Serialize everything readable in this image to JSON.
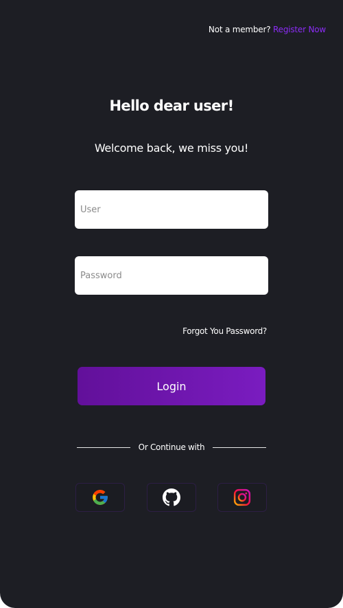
{
  "header": {
    "prompt": "Not a member?",
    "register_link": "Register Now"
  },
  "title": "Hello dear user!",
  "subtitle": "Welcome back, we miss you!",
  "form": {
    "user_placeholder": "User",
    "password_placeholder": "Password",
    "forgot_link": "Forgot You Password?",
    "login_label": "Login"
  },
  "divider_text": "Or Continue with",
  "social": [
    {
      "name": "google-icon"
    },
    {
      "name": "github-icon"
    },
    {
      "name": "instagram-icon"
    }
  ],
  "colors": {
    "background": "#1d1e24",
    "accent": "#8b2cf5",
    "button_start": "#62109a",
    "button_end": "#7a1cc0"
  }
}
